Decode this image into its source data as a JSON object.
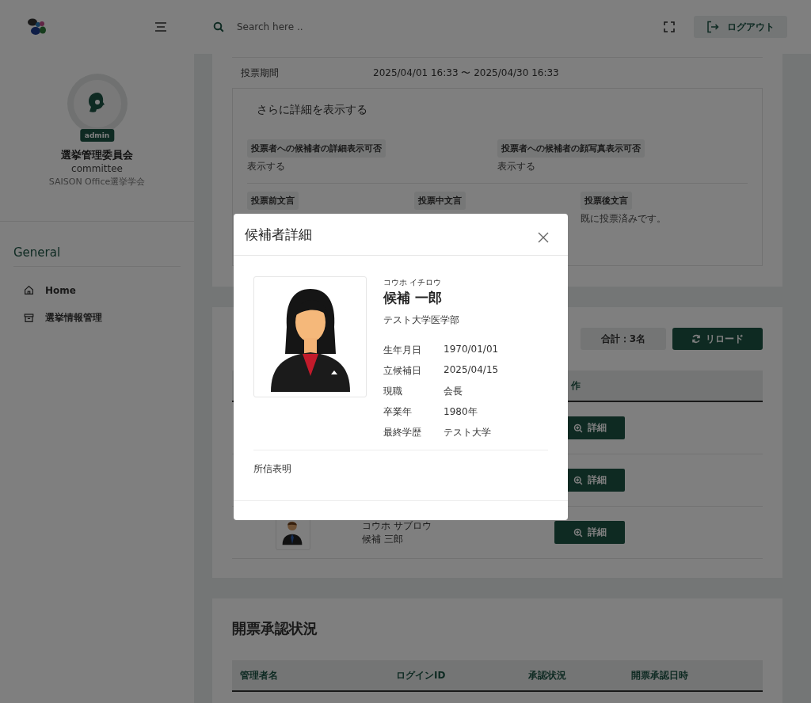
{
  "header": {
    "search": {
      "placeholder": "Search here .."
    },
    "logout_button": "ログアウト"
  },
  "profile": {
    "role_badge": "admin",
    "name": "選挙管理委員会",
    "login_id": "committee",
    "organization": "SAISON Office選挙学会"
  },
  "sidebar": {
    "section_title": "General",
    "items": [
      {
        "label": "Home",
        "kind": "home"
      },
      {
        "label": "選挙情報管理",
        "kind": "archive"
      }
    ]
  },
  "election_card": {
    "period_label": "投票期間",
    "period_value": "2025/04/01 16:33 〜 2025/04/30 16:33",
    "details_title": "さらに詳細を表示する",
    "settings": [
      {
        "label": "投票者への候補者の詳細表示可否",
        "value": "表示する"
      },
      {
        "label": "投票者への候補者の顔写真表示可否",
        "value": "表示する"
      }
    ],
    "messages": [
      {
        "label": "投票前文言"
      },
      {
        "label": "投票中文言"
      },
      {
        "label": "投票後文言",
        "value": "既に投票済みです。"
      }
    ]
  },
  "candidates_card": {
    "total": "合計：3名",
    "reload_button": "リロード",
    "column_header": "作",
    "rows": [
      {
        "detail_button": "詳細"
      },
      {
        "detail_button": "詳細"
      },
      {
        "kana": "コウホ サブロウ",
        "name": "候補 三郎",
        "detail_button": "詳細"
      }
    ]
  },
  "approval_card": {
    "title": "開票承認状況",
    "columns": [
      "管理者名",
      "ログインID",
      "承認状況",
      "開票承認日時"
    ]
  },
  "modal": {
    "title": "候補者詳細",
    "kana": "コウホ イチロウ",
    "name": "候補 一郎",
    "affiliation": "テスト大学医学部",
    "fields": [
      {
        "label": "生年月日",
        "value": "1970/01/01"
      },
      {
        "label": "立候補日",
        "value": "2025/04/15"
      },
      {
        "label": "現職",
        "value": "会長"
      },
      {
        "label": "卒業年",
        "value": "1980年"
      },
      {
        "label": "最終学歴",
        "value": "テスト大学"
      }
    ],
    "statement_label": "所信表明"
  }
}
